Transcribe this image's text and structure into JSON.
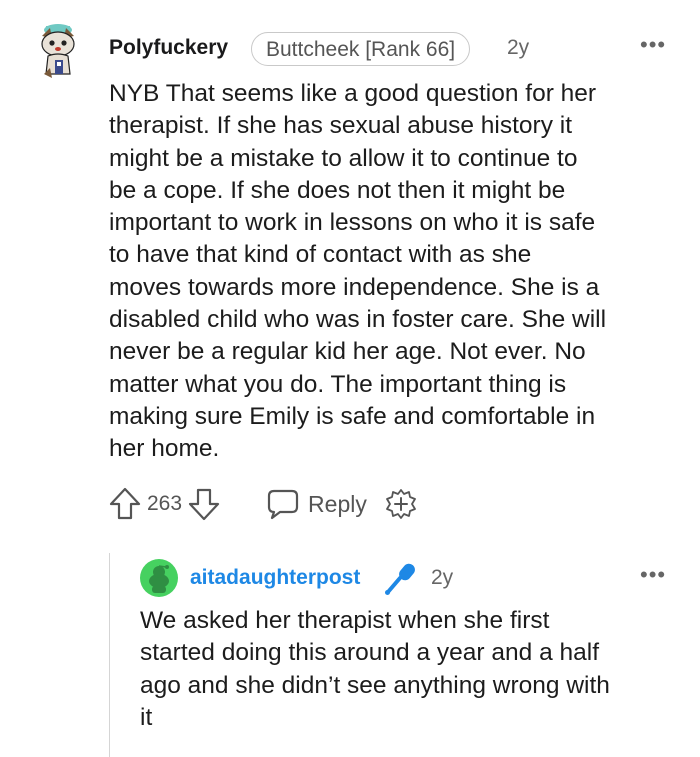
{
  "comment": {
    "username": "Polyfuckery",
    "flair": "Buttcheek [Rank 66]",
    "age": "2y",
    "more": "•••",
    "body_lines": [
      "NYB That seems like a good question for her",
      "therapist. If she has sexual abuse history it",
      "might be a mistake to allow it to continue to",
      "be a cope. If she does not then it might be",
      "important to work in lessons on who it is safe",
      "to have that kind of contact with as she",
      "moves towards more independence. She is a",
      "disabled child who was in foster care. She will",
      "never be a regular kid her age. Not ever. No",
      "matter what you do. The important thing is",
      "making sure Emily is safe and comfortable in",
      "her home."
    ],
    "votes": "263",
    "reply_label": "Reply"
  },
  "reply": {
    "username": "aitadaughterpost",
    "age": "2y",
    "more": "•••",
    "body_lines": [
      "We asked her therapist when she first",
      "started doing this around a year and a half",
      "ago and she didn’t see anything wrong with",
      "it"
    ]
  },
  "colors": {
    "reply_username": "#1e88e5",
    "op_badge": "#1e88e5",
    "snoo_avatar": "#46d160"
  },
  "icons": [
    "snoo-avatar-icon",
    "upvote-icon",
    "downvote-icon",
    "reply-bubble-icon",
    "award-plus-icon",
    "microphone-icon"
  ]
}
